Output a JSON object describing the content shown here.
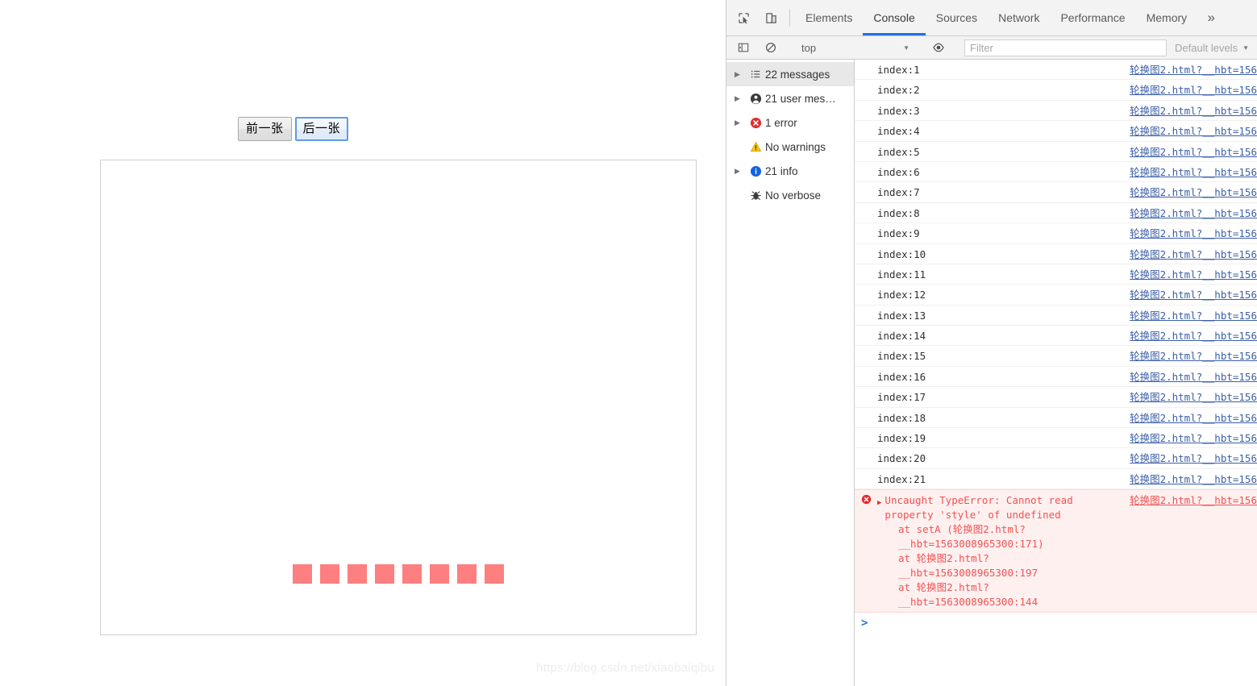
{
  "page": {
    "buttons": [
      {
        "label": "前一张",
        "name": "prev-image-button",
        "focused": false
      },
      {
        "label": "后一张",
        "name": "next-image-button",
        "focused": true
      }
    ],
    "dots_count": 8,
    "dot_color": "#fd7f7f",
    "watermark": "https://blog.csdn.net/xiaobaiqibu"
  },
  "devtools": {
    "tabs": [
      {
        "label": "Elements",
        "active": false
      },
      {
        "label": "Console",
        "active": true
      },
      {
        "label": "Sources",
        "active": false
      },
      {
        "label": "Network",
        "active": false
      },
      {
        "label": "Performance",
        "active": false
      },
      {
        "label": "Memory",
        "active": false
      }
    ],
    "overflow_label": "»",
    "active_tab_color": "#1a73e8",
    "toolbar": {
      "context_value": "top",
      "filter_placeholder": "Filter",
      "filter_value": "",
      "levels_label": "Default levels",
      "caret": "▼"
    },
    "sidebar": [
      {
        "label": "22 messages",
        "icon": "list-icon",
        "expandable": true,
        "selected": true
      },
      {
        "label": "21 user mes…",
        "icon": "user-icon",
        "expandable": true,
        "selected": false
      },
      {
        "label": "1 error",
        "icon": "error-icon",
        "expandable": true,
        "selected": false
      },
      {
        "label": "No warnings",
        "icon": "warning-icon",
        "expandable": false,
        "selected": false
      },
      {
        "label": "21 info",
        "icon": "info-icon",
        "expandable": true,
        "selected": false
      },
      {
        "label": "No verbose",
        "icon": "bug-icon",
        "expandable": false,
        "selected": false
      }
    ],
    "messages": [
      {
        "text": "index:1",
        "source": "轮换图2.html?__hbt=156"
      },
      {
        "text": "index:2",
        "source": "轮换图2.html?__hbt=156"
      },
      {
        "text": "index:3",
        "source": "轮换图2.html?__hbt=156"
      },
      {
        "text": "index:4",
        "source": "轮换图2.html?__hbt=156"
      },
      {
        "text": "index:5",
        "source": "轮换图2.html?__hbt=156"
      },
      {
        "text": "index:6",
        "source": "轮换图2.html?__hbt=156"
      },
      {
        "text": "index:7",
        "source": "轮换图2.html?__hbt=156"
      },
      {
        "text": "index:8",
        "source": "轮换图2.html?__hbt=156"
      },
      {
        "text": "index:9",
        "source": "轮换图2.html?__hbt=156"
      },
      {
        "text": "index:10",
        "source": "轮换图2.html?__hbt=156"
      },
      {
        "text": "index:11",
        "source": "轮换图2.html?__hbt=156"
      },
      {
        "text": "index:12",
        "source": "轮换图2.html?__hbt=156"
      },
      {
        "text": "index:13",
        "source": "轮换图2.html?__hbt=156"
      },
      {
        "text": "index:14",
        "source": "轮换图2.html?__hbt=156"
      },
      {
        "text": "index:15",
        "source": "轮换图2.html?__hbt=156"
      },
      {
        "text": "index:16",
        "source": "轮换图2.html?__hbt=156"
      },
      {
        "text": "index:17",
        "source": "轮换图2.html?__hbt=156"
      },
      {
        "text": "index:18",
        "source": "轮换图2.html?__hbt=156"
      },
      {
        "text": "index:19",
        "source": "轮换图2.html?__hbt=156"
      },
      {
        "text": "index:20",
        "source": "轮换图2.html?__hbt=156"
      },
      {
        "text": "index:21",
        "source": "轮换图2.html?__hbt=156"
      }
    ],
    "error": {
      "message": "Uncaught TypeError: Cannot read property 'style' of undefined",
      "source": "轮换图2.html?__hbt=156",
      "stack": [
        "    at setA (轮换图2.html?__hbt=1563008965300:171)",
        "    at 轮换图2.html?__hbt=1563008965300:197",
        "    at 轮换图2.html?__hbt=1563008965300:144"
      ]
    },
    "prompt": ">"
  }
}
